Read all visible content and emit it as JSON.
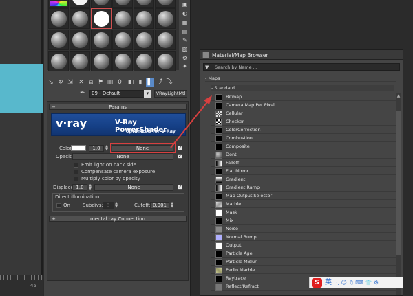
{
  "viewport": {
    "tick_label": "45"
  },
  "material_editor": {
    "material_name": "09 - Default",
    "material_type": "VRayLightMtl",
    "params_title": "Params",
    "banner": {
      "logo": "v·ray",
      "title": "V-Ray PowerShader",
      "subtitle": "optimized for V-Ray"
    },
    "color_label": "Color:",
    "color_value": "1.0",
    "color_map": "None",
    "opacity_label": "Opacity:",
    "opacity_map": "None",
    "emit_back": "Emit light on back side",
    "compensate": "Compensate camera exposure",
    "multiply": "Multiply color by opacity",
    "displace_label": "Displace:",
    "displace_value": "1.0",
    "displace_map": "None",
    "direct_title": "Direct illumination",
    "on_label": "On",
    "subdivs_label": "Subdivs:",
    "subdivs_value": "8",
    "cutoff_label": "Cutoff:",
    "cutoff_value": "0.001",
    "mental_ray": "mental ray Connection"
  },
  "browser": {
    "title": "Material/Map Browser",
    "search_placeholder": "Search by Name ...",
    "cat_maps": "- Maps",
    "cat_standard": "- Standard",
    "items": [
      "Bitmap",
      "Camera Map Per Pixel",
      "Cellular",
      "Checker",
      "ColorCorrection",
      "Combustion",
      "Composite",
      "Dent",
      "Falloff",
      "Flat Mirror",
      "Gradient",
      "Gradient Ramp",
      "Map Output Selector",
      "Marble",
      "Mask",
      "Mix",
      "Noise",
      "Normal Bump",
      "Output",
      "Particle Age",
      "Particle MBlur",
      "Perlin Marble",
      "Raytrace",
      "Reflect/Refract"
    ]
  },
  "ime": {
    "logo": "S",
    "lang": "英",
    "icons": "·, ☺ ♫ ⌨ 👕 ⚙"
  },
  "colors": {
    "accent_red": "#d64040",
    "banner_blue": "#1a4690",
    "viewport_cyan": "#58b8cc"
  }
}
